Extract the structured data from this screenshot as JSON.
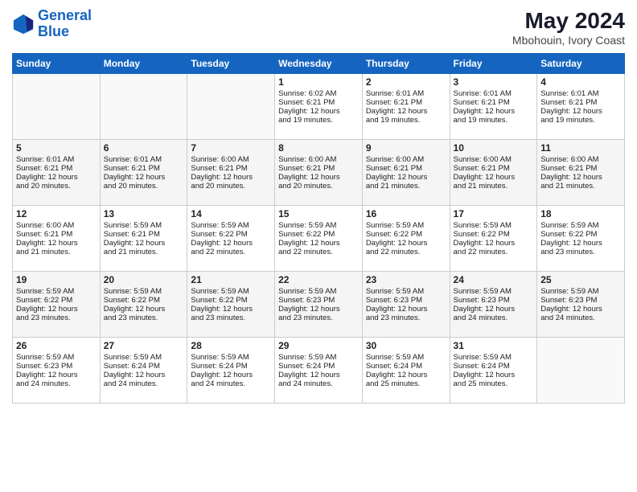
{
  "header": {
    "logo_line1": "General",
    "logo_line2": "Blue",
    "month_year": "May 2024",
    "location": "Mbohouin, Ivory Coast"
  },
  "weekdays": [
    "Sunday",
    "Monday",
    "Tuesday",
    "Wednesday",
    "Thursday",
    "Friday",
    "Saturday"
  ],
  "weeks": [
    [
      {
        "day": "",
        "info": ""
      },
      {
        "day": "",
        "info": ""
      },
      {
        "day": "",
        "info": ""
      },
      {
        "day": "1",
        "info": "Sunrise: 6:02 AM\nSunset: 6:21 PM\nDaylight: 12 hours\nand 19 minutes."
      },
      {
        "day": "2",
        "info": "Sunrise: 6:01 AM\nSunset: 6:21 PM\nDaylight: 12 hours\nand 19 minutes."
      },
      {
        "day": "3",
        "info": "Sunrise: 6:01 AM\nSunset: 6:21 PM\nDaylight: 12 hours\nand 19 minutes."
      },
      {
        "day": "4",
        "info": "Sunrise: 6:01 AM\nSunset: 6:21 PM\nDaylight: 12 hours\nand 19 minutes."
      }
    ],
    [
      {
        "day": "5",
        "info": "Sunrise: 6:01 AM\nSunset: 6:21 PM\nDaylight: 12 hours\nand 20 minutes."
      },
      {
        "day": "6",
        "info": "Sunrise: 6:01 AM\nSunset: 6:21 PM\nDaylight: 12 hours\nand 20 minutes."
      },
      {
        "day": "7",
        "info": "Sunrise: 6:00 AM\nSunset: 6:21 PM\nDaylight: 12 hours\nand 20 minutes."
      },
      {
        "day": "8",
        "info": "Sunrise: 6:00 AM\nSunset: 6:21 PM\nDaylight: 12 hours\nand 20 minutes."
      },
      {
        "day": "9",
        "info": "Sunrise: 6:00 AM\nSunset: 6:21 PM\nDaylight: 12 hours\nand 21 minutes."
      },
      {
        "day": "10",
        "info": "Sunrise: 6:00 AM\nSunset: 6:21 PM\nDaylight: 12 hours\nand 21 minutes."
      },
      {
        "day": "11",
        "info": "Sunrise: 6:00 AM\nSunset: 6:21 PM\nDaylight: 12 hours\nand 21 minutes."
      }
    ],
    [
      {
        "day": "12",
        "info": "Sunrise: 6:00 AM\nSunset: 6:21 PM\nDaylight: 12 hours\nand 21 minutes."
      },
      {
        "day": "13",
        "info": "Sunrise: 5:59 AM\nSunset: 6:21 PM\nDaylight: 12 hours\nand 21 minutes."
      },
      {
        "day": "14",
        "info": "Sunrise: 5:59 AM\nSunset: 6:22 PM\nDaylight: 12 hours\nand 22 minutes."
      },
      {
        "day": "15",
        "info": "Sunrise: 5:59 AM\nSunset: 6:22 PM\nDaylight: 12 hours\nand 22 minutes."
      },
      {
        "day": "16",
        "info": "Sunrise: 5:59 AM\nSunset: 6:22 PM\nDaylight: 12 hours\nand 22 minutes."
      },
      {
        "day": "17",
        "info": "Sunrise: 5:59 AM\nSunset: 6:22 PM\nDaylight: 12 hours\nand 22 minutes."
      },
      {
        "day": "18",
        "info": "Sunrise: 5:59 AM\nSunset: 6:22 PM\nDaylight: 12 hours\nand 23 minutes."
      }
    ],
    [
      {
        "day": "19",
        "info": "Sunrise: 5:59 AM\nSunset: 6:22 PM\nDaylight: 12 hours\nand 23 minutes."
      },
      {
        "day": "20",
        "info": "Sunrise: 5:59 AM\nSunset: 6:22 PM\nDaylight: 12 hours\nand 23 minutes."
      },
      {
        "day": "21",
        "info": "Sunrise: 5:59 AM\nSunset: 6:22 PM\nDaylight: 12 hours\nand 23 minutes."
      },
      {
        "day": "22",
        "info": "Sunrise: 5:59 AM\nSunset: 6:23 PM\nDaylight: 12 hours\nand 23 minutes."
      },
      {
        "day": "23",
        "info": "Sunrise: 5:59 AM\nSunset: 6:23 PM\nDaylight: 12 hours\nand 23 minutes."
      },
      {
        "day": "24",
        "info": "Sunrise: 5:59 AM\nSunset: 6:23 PM\nDaylight: 12 hours\nand 24 minutes."
      },
      {
        "day": "25",
        "info": "Sunrise: 5:59 AM\nSunset: 6:23 PM\nDaylight: 12 hours\nand 24 minutes."
      }
    ],
    [
      {
        "day": "26",
        "info": "Sunrise: 5:59 AM\nSunset: 6:23 PM\nDaylight: 12 hours\nand 24 minutes."
      },
      {
        "day": "27",
        "info": "Sunrise: 5:59 AM\nSunset: 6:24 PM\nDaylight: 12 hours\nand 24 minutes."
      },
      {
        "day": "28",
        "info": "Sunrise: 5:59 AM\nSunset: 6:24 PM\nDaylight: 12 hours\nand 24 minutes."
      },
      {
        "day": "29",
        "info": "Sunrise: 5:59 AM\nSunset: 6:24 PM\nDaylight: 12 hours\nand 24 minutes."
      },
      {
        "day": "30",
        "info": "Sunrise: 5:59 AM\nSunset: 6:24 PM\nDaylight: 12 hours\nand 25 minutes."
      },
      {
        "day": "31",
        "info": "Sunrise: 5:59 AM\nSunset: 6:24 PM\nDaylight: 12 hours\nand 25 minutes."
      },
      {
        "day": "",
        "info": ""
      }
    ]
  ]
}
